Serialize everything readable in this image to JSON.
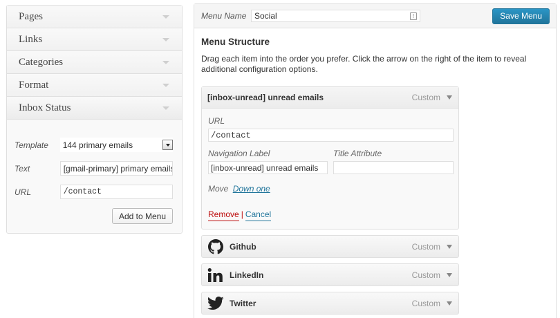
{
  "sidebar": {
    "sections": [
      {
        "label": "Pages"
      },
      {
        "label": "Links"
      },
      {
        "label": "Categories"
      },
      {
        "label": "Format"
      },
      {
        "label": "Inbox Status"
      }
    ],
    "inbox_form": {
      "template_label": "Template",
      "template_value": "144 primary emails",
      "text_label": "Text",
      "text_value": "[gmail-primary] primary emails",
      "url_label": "URL",
      "url_value": "/contact",
      "add_button": "Add to Menu"
    }
  },
  "header": {
    "menu_name_label": "Menu Name",
    "menu_name_value": "Social",
    "save_button": "Save Menu"
  },
  "structure": {
    "title": "Menu Structure",
    "description": "Drag each item into the order you prefer. Click the arrow on the right of the item to reveal additional configuration options."
  },
  "open_item": {
    "title": "[inbox-unread] unread emails",
    "type": "Custom",
    "url_label": "URL",
    "url_value": "/contact",
    "nav_label": "Navigation Label",
    "nav_value": "[inbox-unread] unread emails",
    "title_attr_label": "Title Attribute",
    "title_attr_value": "",
    "move_label": "Move",
    "move_link": "Down one",
    "remove": "Remove",
    "separator": "|",
    "cancel": "Cancel"
  },
  "items": [
    {
      "title": "Github",
      "type": "Custom",
      "icon": "github-icon"
    },
    {
      "title": "LinkedIn",
      "type": "Custom",
      "icon": "linkedin-icon"
    },
    {
      "title": "Twitter",
      "type": "Custom",
      "icon": "twitter-icon"
    }
  ],
  "colors": {
    "primary_button": "#21759b",
    "remove": "#bc0b0b",
    "link": "#21759b"
  }
}
